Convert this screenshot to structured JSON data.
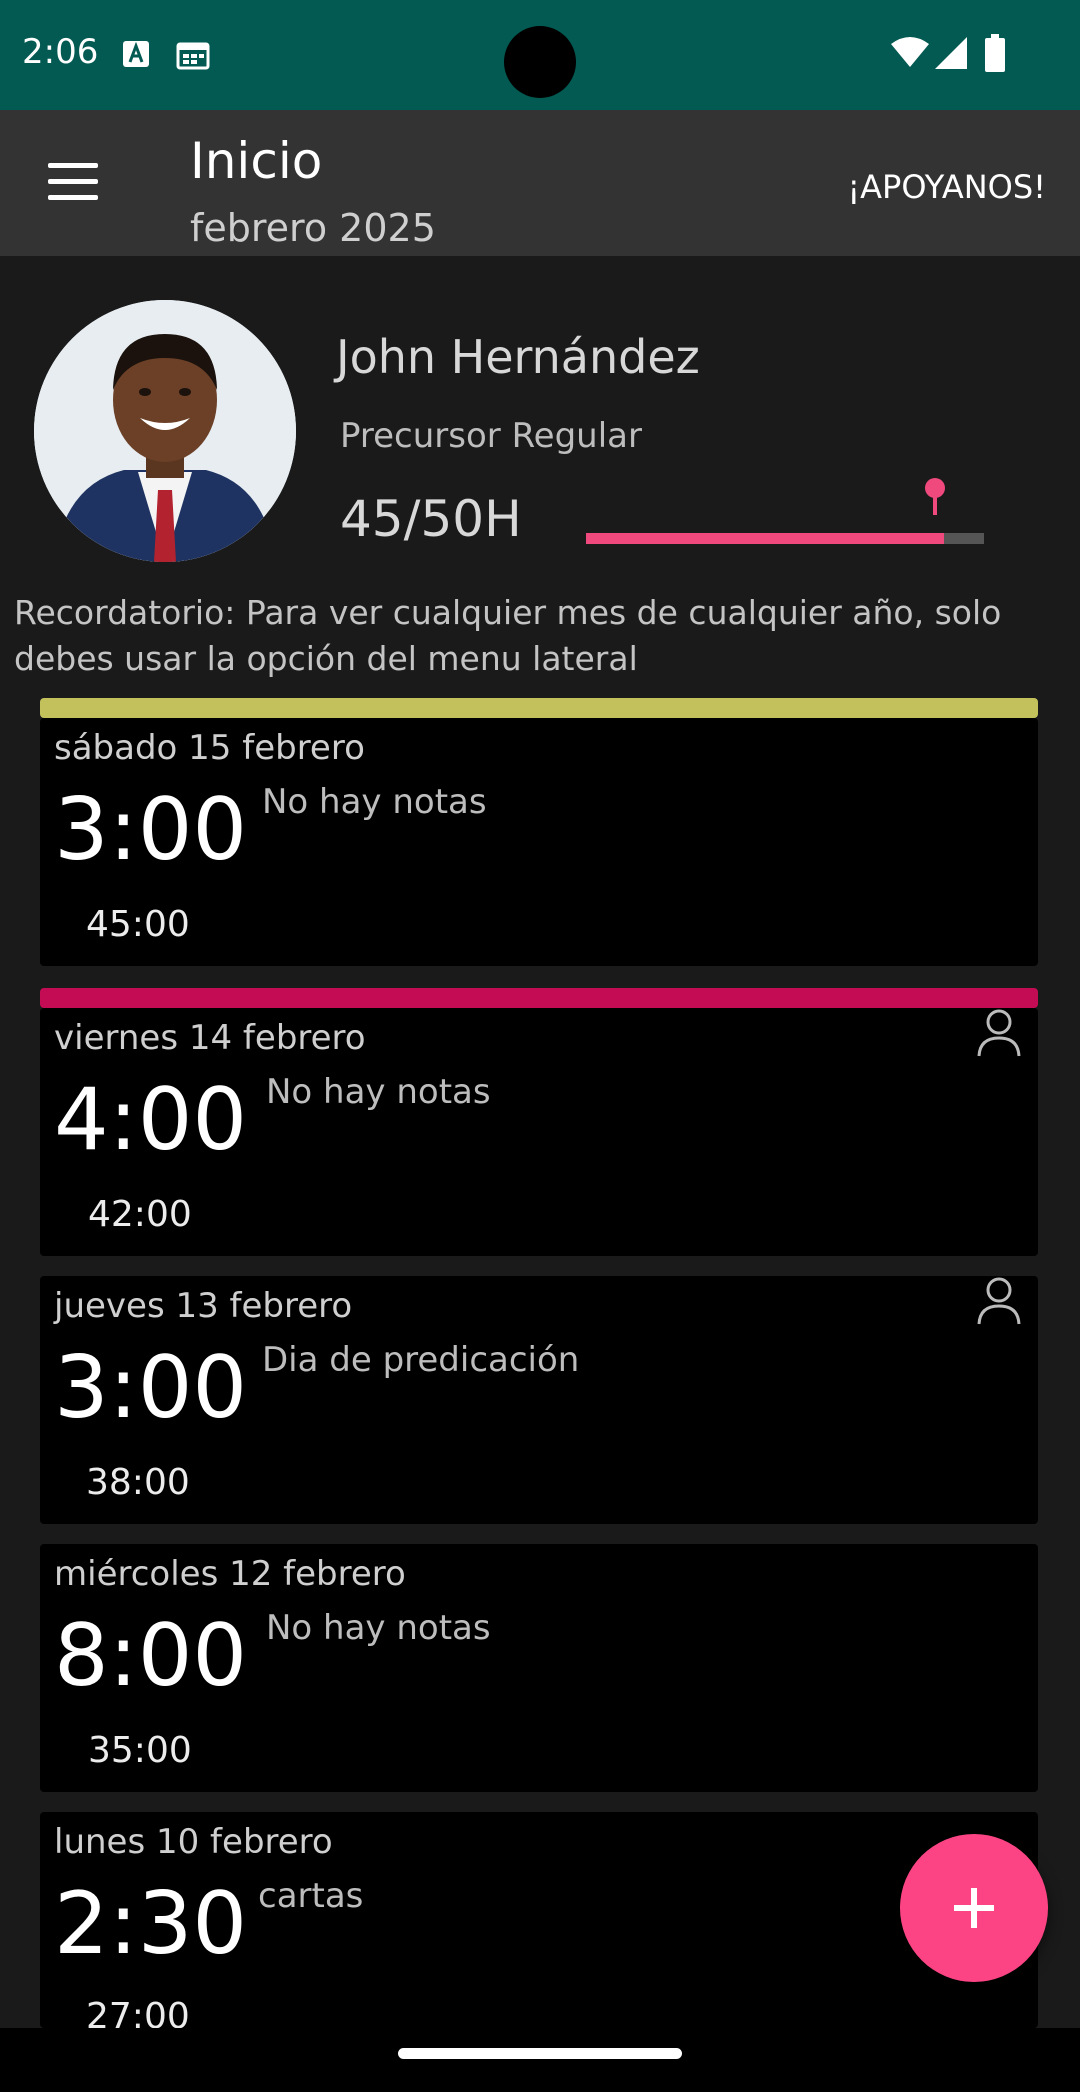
{
  "status_bar": {
    "time": "2:06",
    "left_icons": [
      "text-a-icon",
      "calendar-icon"
    ],
    "right_icons": [
      "wifi-icon",
      "cell-signal-icon",
      "battery-icon"
    ]
  },
  "app_bar": {
    "title": "Inicio",
    "subtitle": "febrero 2025",
    "action_label": "¡APOYANOS!"
  },
  "profile": {
    "name": "John Hernández",
    "role": "Precursor Regular",
    "hours_label": "45/50H",
    "progress_fraction": 0.9,
    "accent_color": "#f0497e"
  },
  "reminder": "Recordatorio: Para ver cualquier mes de cualquier año, solo debes usar la opción del menu lateral",
  "entries": [
    {
      "date": "sábado 15 febrero",
      "hours": "3:00",
      "total": "45:00",
      "note": "No hay notas",
      "bar_color": "#c3c15b",
      "has_person_icon": false
    },
    {
      "date": "viernes 14 febrero",
      "hours": "4:00",
      "total": "42:00",
      "note": "No hay notas",
      "bar_color": "#c40c55",
      "has_person_icon": true
    },
    {
      "date": "jueves 13 febrero",
      "hours": "3:00",
      "total": "38:00",
      "note": "Dia de predicación",
      "bar_color": null,
      "has_person_icon": true
    },
    {
      "date": "miércoles 12 febrero",
      "hours": "8:00",
      "total": "35:00",
      "note": "No hay notas",
      "bar_color": null,
      "has_person_icon": false
    },
    {
      "date": "lunes 10 febrero",
      "hours": "2:30",
      "total": "27:00",
      "note": "cartas",
      "bar_color": null,
      "has_person_icon": false
    }
  ],
  "fab": {
    "icon": "plus-icon",
    "color": "#fc4484"
  }
}
